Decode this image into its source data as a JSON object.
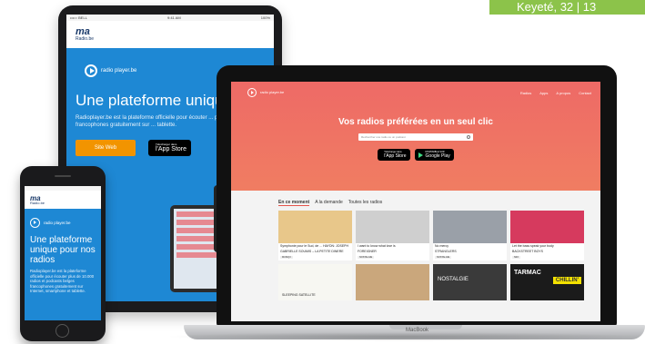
{
  "corner_tag": "Keyeté, 32 | 13",
  "tablet": {
    "status_left": "••••○ BELL",
    "status_time": "9:41 AM",
    "status_right": "100%",
    "logo_ma": "ma",
    "logo_radio": "Radio.be",
    "rp_logo": "radio player.be",
    "headline": "Une plateforme unique pour",
    "paragraph": "Radioplayer.be est la plateforme officielle pour écouter ... podcasts belges francophones gratuitement sur ... tablette.",
    "btn_web": "Site Web",
    "appstore_small": "Télécharger dans",
    "appstore_big": "l'App Store"
  },
  "laptop": {
    "nav_logo": "radio player.be",
    "nav_links": [
      "Radios",
      "Apps",
      "A propos",
      "Contact"
    ],
    "hero_title": "Vos radios préférées en un seul clic",
    "search_placeholder": "Rechercher une radio ou un podcast",
    "appstore_small": "Télécharger dans",
    "appstore_big": "l'App Store",
    "gplay_small": "DISPONIBLE SUR",
    "gplay_big": "Google Play",
    "tabs": [
      "En ce moment",
      "A la demande",
      "Toutes les radios"
    ],
    "cards": [
      {
        "caption": "Symphonie pour le Sud, de ... HAYDN: JOSEPH",
        "sub": "GABRIELLE SOUMIS – LA PETITE DINERE",
        "tag": "MUSIQ3",
        "color": "#e8c78a"
      },
      {
        "caption": "I want to know what love is",
        "sub": "FOREIGNER",
        "tag": "NOSTALGIE",
        "color": "#cfcfcf"
      },
      {
        "caption": "No mercy",
        "sub": "STRANGLERS",
        "tag": "NOSTALGIE",
        "color": "#9aa0a8"
      },
      {
        "caption": "Let the bass speak your body",
        "sub": "BACKSTREET BOYS",
        "tag": "NRJ",
        "color": "#d63a5e"
      },
      {
        "caption": "SLEEPING SATELLITE",
        "sub": "",
        "tag": "",
        "color": "#ffffff"
      },
      {
        "caption": "",
        "sub": "",
        "tag": "",
        "color": "#caa77c"
      },
      {
        "caption": "NOSTALGIE",
        "sub": "",
        "tag": "",
        "color": "#3a3a3a"
      },
      {
        "caption": "TARMAC",
        "sub": "CHILLIN'",
        "tag": "",
        "color": "#1b1b1b"
      }
    ],
    "base_label": "MacBook"
  },
  "phone": {
    "logo_ma": "ma",
    "logo_radio": "Radio.be",
    "rp_logo": "radio player.be",
    "headline": "Une plateforme unique pour nos radios",
    "paragraph": "Radioplayer.be est la plateforme officielle pour écouter plus de 10.000 radios et podcasts belges francophones gratuitement sur Internet, smartphone et tablette."
  },
  "colors": {
    "hero_red": "#ee6a66",
    "brand_blue": "#1e88d4",
    "orange": "#f29400",
    "green_tag": "#8cc34a"
  }
}
